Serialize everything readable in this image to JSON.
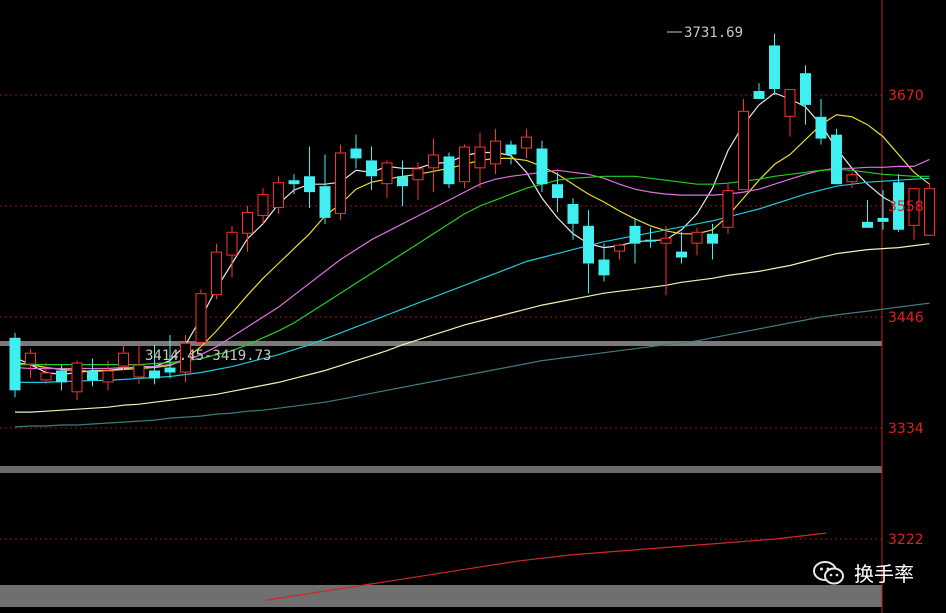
{
  "chart_data": {
    "type": "candlestick",
    "ylim": [
      3160,
      3780
    ],
    "yticks": [
      "3670",
      "3558",
      "3446",
      "3334",
      "3222"
    ],
    "grid": true,
    "annotations": {
      "high_label": "3731.69",
      "range_label": "3414.45-3419.73"
    },
    "ohlc": [
      [
        3425,
        3430,
        3365,
        3372
      ],
      [
        3398,
        3414,
        3385,
        3410
      ],
      [
        3382,
        3400,
        3378,
        3390
      ],
      [
        3392,
        3398,
        3372,
        3380
      ],
      [
        3370,
        3402,
        3362,
        3400
      ],
      [
        3392,
        3404,
        3376,
        3382
      ],
      [
        3380,
        3402,
        3372,
        3392
      ],
      [
        3396,
        3418,
        3392,
        3410
      ],
      [
        3385,
        3418,
        3378,
        3398
      ],
      [
        3392,
        3418,
        3378,
        3384
      ],
      [
        3395,
        3428,
        3384,
        3390
      ],
      [
        3390,
        3428,
        3380,
        3420
      ],
      [
        3420,
        3474,
        3416,
        3470
      ],
      [
        3468,
        3520,
        3464,
        3512
      ],
      [
        3508,
        3538,
        3486,
        3532
      ],
      [
        3530,
        3558,
        3512,
        3552
      ],
      [
        3548,
        3576,
        3540,
        3570
      ],
      [
        3556,
        3588,
        3550,
        3582
      ],
      [
        3584,
        3590,
        3570,
        3580
      ],
      [
        3588,
        3618,
        3556,
        3572
      ],
      [
        3578,
        3610,
        3540,
        3546
      ],
      [
        3550,
        3620,
        3544,
        3612
      ],
      [
        3616,
        3630,
        3596,
        3606
      ],
      [
        3604,
        3618,
        3574,
        3588
      ],
      [
        3580,
        3604,
        3566,
        3602
      ],
      [
        3588,
        3604,
        3558,
        3578
      ],
      [
        3584,
        3602,
        3564,
        3596
      ],
      [
        3596,
        3626,
        3572,
        3610
      ],
      [
        3608,
        3612,
        3576,
        3580
      ],
      [
        3582,
        3620,
        3576,
        3618
      ],
      [
        3596,
        3632,
        3576,
        3618
      ],
      [
        3600,
        3636,
        3590,
        3624
      ],
      [
        3620,
        3624,
        3600,
        3610
      ],
      [
        3616,
        3636,
        3606,
        3628
      ],
      [
        3616,
        3624,
        3572,
        3580
      ],
      [
        3580,
        3592,
        3552,
        3566
      ],
      [
        3560,
        3566,
        3524,
        3540
      ],
      [
        3538,
        3554,
        3470,
        3500
      ],
      [
        3504,
        3520,
        3482,
        3488
      ],
      [
        3512,
        3520,
        3504,
        3519
      ],
      [
        3538,
        3546,
        3500,
        3520
      ],
      [
        3524,
        3536,
        3516,
        3522
      ],
      [
        3520,
        3538,
        3468,
        3526
      ],
      [
        3512,
        3532,
        3500,
        3506
      ],
      [
        3520,
        3536,
        3508,
        3532
      ],
      [
        3530,
        3540,
        3504,
        3520
      ],
      [
        3536,
        3580,
        3530,
        3574
      ],
      [
        3574,
        3666,
        3574,
        3654
      ],
      [
        3674,
        3682,
        3666,
        3666
      ],
      [
        3720,
        3732,
        3670,
        3676
      ],
      [
        3648,
        3676,
        3628,
        3676
      ],
      [
        3692,
        3700,
        3640,
        3660
      ],
      [
        3648,
        3666,
        3620,
        3626
      ],
      [
        3630,
        3636,
        3580,
        3580
      ],
      [
        3582,
        3592,
        3576,
        3590
      ],
      [
        3542,
        3564,
        3538,
        3536
      ],
      [
        3546,
        3574,
        3534,
        3542
      ],
      [
        3582,
        3590,
        3532,
        3534
      ],
      [
        3538,
        3574,
        3524,
        3576
      ],
      [
        3528,
        3580,
        3530,
        3576
      ]
    ],
    "ma": [
      {
        "color": "#e8e8e8",
        "values": [
          3405,
          3398,
          3390,
          3388,
          3390,
          3392,
          3392,
          3394,
          3396,
          3396,
          3402,
          3418,
          3445,
          3475,
          3500,
          3525,
          3540,
          3560,
          3574,
          3580,
          3580,
          3582,
          3594,
          3592,
          3598,
          3596,
          3596,
          3601,
          3602,
          3609,
          3612,
          3612,
          3609,
          3592,
          3566,
          3546,
          3530,
          3520,
          3516,
          3518,
          3522,
          3523,
          3524,
          3534,
          3550,
          3576,
          3614,
          3640,
          3660,
          3672,
          3666,
          3658,
          3640,
          3616,
          3596,
          3580,
          3567,
          3558
        ]
      },
      {
        "color": "#e8e020",
        "values": [
          3400,
          3398,
          3395,
          3393,
          3392,
          3391,
          3392,
          3393,
          3394,
          3395,
          3397,
          3404,
          3416,
          3432,
          3450,
          3468,
          3485,
          3500,
          3515,
          3530,
          3548,
          3560,
          3575,
          3582,
          3585,
          3588,
          3590,
          3593,
          3596,
          3600,
          3604,
          3606,
          3606,
          3604,
          3598,
          3590,
          3580,
          3570,
          3562,
          3553,
          3545,
          3538,
          3533,
          3530,
          3530,
          3534,
          3548,
          3566,
          3584,
          3600,
          3610,
          3625,
          3640,
          3650,
          3648,
          3640,
          3628,
          3610,
          3592,
          3580
        ]
      },
      {
        "color": "#e070e0",
        "values": [
          3395,
          3394,
          3394,
          3394,
          3394,
          3394,
          3394,
          3395,
          3395,
          3396,
          3398,
          3402,
          3408,
          3416,
          3426,
          3436,
          3446,
          3456,
          3468,
          3480,
          3492,
          3504,
          3514,
          3524,
          3532,
          3540,
          3548,
          3556,
          3564,
          3572,
          3580,
          3585,
          3588,
          3590,
          3592,
          3594,
          3592,
          3590,
          3586,
          3580,
          3575,
          3572,
          3570,
          3569,
          3569,
          3569,
          3570,
          3572,
          3575,
          3580,
          3585,
          3590,
          3594,
          3596,
          3596,
          3597,
          3597,
          3598,
          3598,
          3605
        ]
      },
      {
        "color": "#20d020",
        "values": [
          3398,
          3398,
          3398,
          3398,
          3398,
          3398,
          3398,
          3398,
          3398,
          3399,
          3400,
          3402,
          3404,
          3408,
          3412,
          3418,
          3425,
          3432,
          3440,
          3450,
          3460,
          3470,
          3480,
          3490,
          3500,
          3510,
          3520,
          3530,
          3540,
          3550,
          3558,
          3564,
          3570,
          3576,
          3580,
          3584,
          3586,
          3587,
          3588,
          3588,
          3588,
          3586,
          3584,
          3582,
          3580,
          3580,
          3581,
          3583,
          3585,
          3588,
          3590,
          3592,
          3594,
          3595,
          3594,
          3592,
          3590,
          3589,
          3588,
          3588
        ]
      },
      {
        "color": "#20c8d8",
        "values": [
          3380,
          3380,
          3380,
          3381,
          3381,
          3382,
          3382,
          3383,
          3384,
          3385,
          3386,
          3388,
          3390,
          3393,
          3396,
          3400,
          3404,
          3408,
          3413,
          3418,
          3424,
          3430,
          3436,
          3442,
          3448,
          3454,
          3460,
          3466,
          3472,
          3478,
          3484,
          3490,
          3496,
          3502,
          3506,
          3510,
          3514,
          3518,
          3522,
          3525,
          3528,
          3531,
          3534,
          3537,
          3540,
          3543,
          3547,
          3551,
          3555,
          3560,
          3565,
          3570,
          3574,
          3578,
          3580,
          3582,
          3583,
          3584,
          3585,
          3586
        ]
      },
      {
        "color": "#f0f0b4",
        "values": [
          3350,
          3350,
          3351,
          3352,
          3353,
          3354,
          3355,
          3357,
          3358,
          3360,
          3362,
          3364,
          3366,
          3368,
          3371,
          3374,
          3377,
          3380,
          3384,
          3388,
          3392,
          3397,
          3402,
          3407,
          3412,
          3418,
          3423,
          3428,
          3433,
          3438,
          3442,
          3446,
          3450,
          3454,
          3458,
          3461,
          3464,
          3467,
          3470,
          3472,
          3474,
          3476,
          3478,
          3481,
          3483,
          3485,
          3488,
          3490,
          3492,
          3495,
          3498,
          3502,
          3506,
          3510,
          3512,
          3514,
          3515,
          3516,
          3518,
          3520
        ]
      },
      {
        "color": "#407a80",
        "values": [
          3335,
          3336,
          3336,
          3337,
          3337,
          3338,
          3339,
          3340,
          3341,
          3342,
          3344,
          3345,
          3346,
          3348,
          3349,
          3351,
          3352,
          3354,
          3356,
          3358,
          3360,
          3363,
          3366,
          3369,
          3372,
          3375,
          3378,
          3381,
          3384,
          3387,
          3390,
          3393,
          3396,
          3399,
          3402,
          3404,
          3406,
          3408,
          3410,
          3412,
          3414,
          3416,
          3418,
          3420,
          3422,
          3425,
          3428,
          3431,
          3434,
          3437,
          3440,
          3443,
          3446,
          3448,
          3450,
          3452,
          3454,
          3456,
          3458,
          3460
        ]
      }
    ],
    "long_ma": {
      "color": "#d02828",
      "values": [
        3160,
        3168,
        3176,
        3184,
        3192,
        3200,
        3206,
        3210,
        3214,
        3218,
        3222,
        3228
      ]
    }
  },
  "watermark": {
    "text": "换手率",
    "icon": "wechat-icon"
  }
}
